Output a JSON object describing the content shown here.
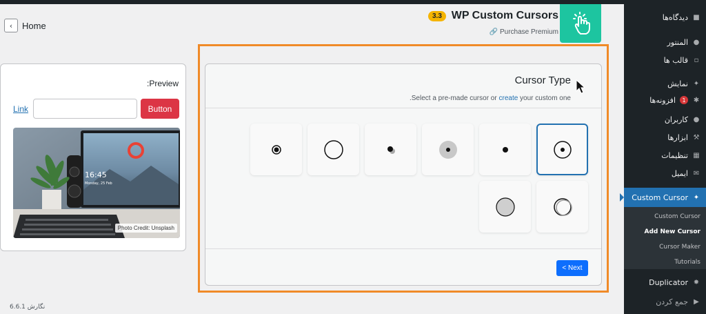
{
  "home": {
    "label": "Home"
  },
  "plugin": {
    "version": "3.3",
    "name": "WP Custom Cursors",
    "purchase": "Purchase Premium"
  },
  "preview": {
    "title": ":Preview",
    "link_label": "Link",
    "input_value": "",
    "button_label": "Button",
    "photo_credit": "Photo Credit: Unsplash"
  },
  "cursor_type": {
    "title": "Cursor Type",
    "subtitle_before": ".Select a pre-made cursor or ",
    "subtitle_link": "create",
    "subtitle_after": " your custom one",
    "selected_index": 0,
    "next_label": "< Next"
  },
  "footer": {
    "version": "نگارش 6.6.1"
  },
  "sidebar": {
    "items": [
      {
        "label": "دیدگاه‌ها",
        "icon": "comment-icon"
      },
      {
        "label": "المنتور",
        "icon": "elementor-icon"
      },
      {
        "label": "قالب ها",
        "icon": "folder-icon"
      },
      {
        "label": "نمایش",
        "icon": "brush-icon"
      },
      {
        "label": "افزونه‌ها",
        "icon": "plugin-icon",
        "badge": "1"
      },
      {
        "label": "کاربران",
        "icon": "user-icon"
      },
      {
        "label": "ابزارها",
        "icon": "wrench-icon"
      },
      {
        "label": "تنظیمات",
        "icon": "settings-icon"
      },
      {
        "label": "ایمیل",
        "icon": "mail-icon"
      }
    ],
    "active": {
      "label": "Custom Cursor",
      "icon": "cursor-icon"
    },
    "submenu": [
      "Custom Cursor",
      "Add New Cursor",
      "Cursor Maker",
      "Tutorials"
    ],
    "current_sub": "Add New Cursor",
    "after": [
      {
        "label": "Duplicator",
        "icon": "duplicator-icon"
      },
      {
        "label": "جمع کردن",
        "icon": "collapse-icon"
      }
    ]
  },
  "colors": {
    "accent": "#2271b1",
    "highlight": "#f08a28",
    "logo": "#1dc5a0",
    "danger": "#dc3545"
  }
}
